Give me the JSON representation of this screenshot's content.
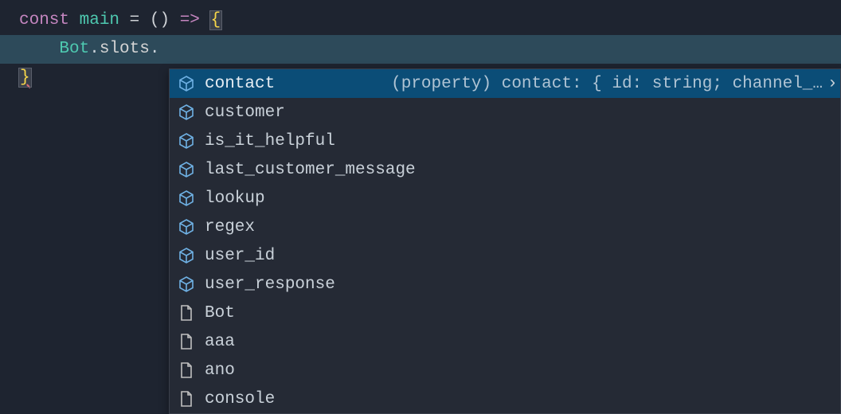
{
  "code": {
    "line1": {
      "const": "const",
      "space1": " ",
      "main": "main",
      "space2": " ",
      "eq": "=",
      "space3": " ",
      "paren_open": "(",
      "paren_close": ")",
      "space4": " ",
      "arrow": "=>",
      "space5": " ",
      "brace_open": "{"
    },
    "line2": {
      "indent": "    ",
      "bot": "Bot",
      "dot1": ".",
      "slots": "slots",
      "dot2": "."
    },
    "line3": {
      "brace_close": "}"
    }
  },
  "suggest": {
    "items": [
      {
        "label": "contact",
        "icon": "field",
        "detail": "(property) contact: { id: string; channel_…",
        "selected": true
      },
      {
        "label": "customer",
        "icon": "field",
        "detail": "",
        "selected": false
      },
      {
        "label": "is_it_helpful",
        "icon": "field",
        "detail": "",
        "selected": false
      },
      {
        "label": "last_customer_message",
        "icon": "field",
        "detail": "",
        "selected": false
      },
      {
        "label": "lookup",
        "icon": "field",
        "detail": "",
        "selected": false
      },
      {
        "label": "regex",
        "icon": "field",
        "detail": "",
        "selected": false
      },
      {
        "label": "user_id",
        "icon": "field",
        "detail": "",
        "selected": false
      },
      {
        "label": "user_response",
        "icon": "field",
        "detail": "",
        "selected": false
      },
      {
        "label": "Bot",
        "icon": "file",
        "detail": "",
        "selected": false
      },
      {
        "label": "aaa",
        "icon": "file",
        "detail": "",
        "selected": false
      },
      {
        "label": "ano",
        "icon": "file",
        "detail": "",
        "selected": false
      },
      {
        "label": "console",
        "icon": "file",
        "detail": "",
        "selected": false
      }
    ],
    "more_glyph": "›"
  }
}
